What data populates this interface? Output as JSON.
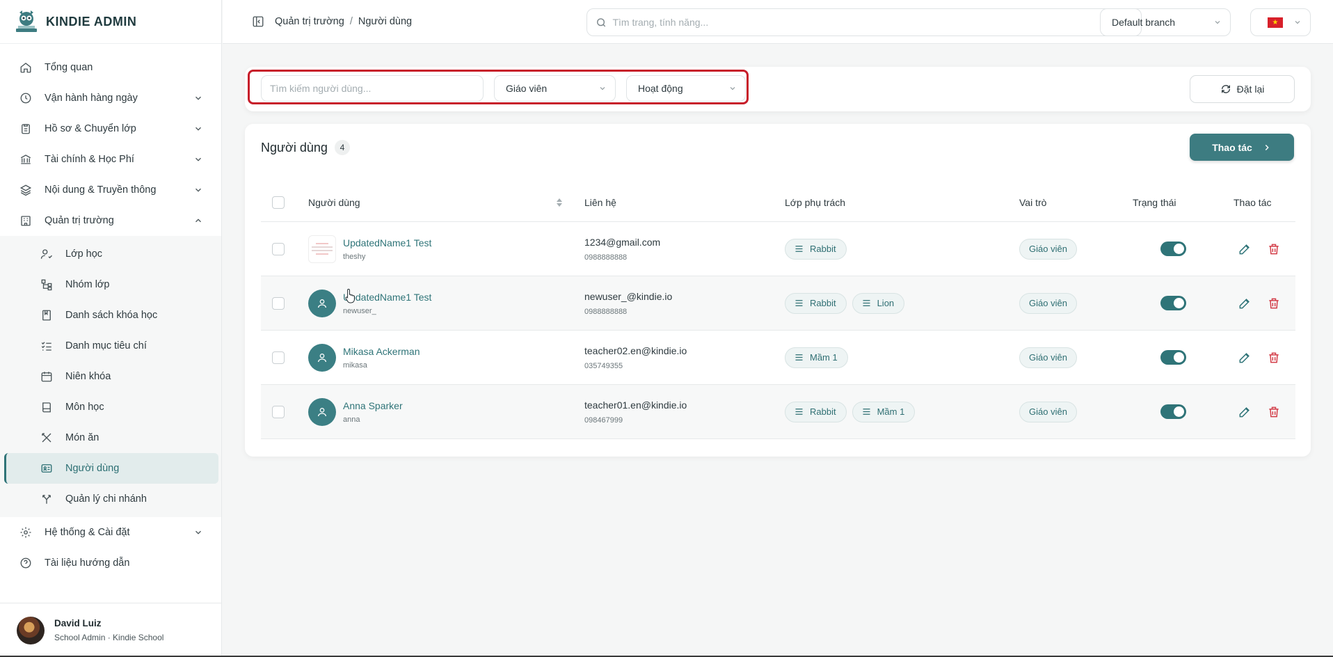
{
  "brand": {
    "name": "KINDIE ADMIN"
  },
  "sidebar": {
    "items": [
      {
        "label": "Tổng quan",
        "icon": "home-icon"
      },
      {
        "label": "Vận hành hàng ngày",
        "icon": "clock-icon"
      },
      {
        "label": "Hồ sơ & Chuyển lớp",
        "icon": "clipboard-icon"
      },
      {
        "label": "Tài chính & Học Phí",
        "icon": "bank-icon"
      },
      {
        "label": "Nội dung & Truyền thông",
        "icon": "layers-icon"
      },
      {
        "label": "Quản trị trường",
        "icon": "building-icon"
      }
    ],
    "subitems": [
      {
        "label": "Lớp học",
        "icon": "user-check-icon"
      },
      {
        "label": "Nhóm lớp",
        "icon": "tree-icon"
      },
      {
        "label": "Danh sách khóa học",
        "icon": "bookmark-icon"
      },
      {
        "label": "Danh mục tiêu chí",
        "icon": "list-check-icon"
      },
      {
        "label": "Niên khóa",
        "icon": "calendar-icon"
      },
      {
        "label": "Môn học",
        "icon": "book-icon"
      },
      {
        "label": "Món ăn",
        "icon": "utensils-icon"
      },
      {
        "label": "Người dùng",
        "icon": "id-card-icon"
      },
      {
        "label": "Quản lý chi nhánh",
        "icon": "branch-icon"
      }
    ],
    "bottom_items": [
      {
        "label": "Hệ thống & Cài đặt",
        "icon": "gear-icon"
      },
      {
        "label": "Tài liệu hướng dẫn",
        "icon": "help-icon"
      }
    ]
  },
  "profile": {
    "name": "David Luiz",
    "role": "School Admin · Kindie School"
  },
  "header": {
    "breadcrumb": [
      "Quản trị trường",
      "/",
      "Người dùng"
    ],
    "search_placeholder": "Tìm trang, tính năng...",
    "branch": "Default branch"
  },
  "filters": {
    "search_placeholder": "Tìm kiếm người dùng...",
    "role": "Giáo viên",
    "status": "Hoạt động",
    "reset_label": "Đặt lại"
  },
  "users_card": {
    "title": "Người dùng",
    "count": "4",
    "action_label": "Thao tác"
  },
  "table": {
    "headers": {
      "user": "Người dùng",
      "contact": "Liên hệ",
      "classes": "Lớp phụ trách",
      "role": "Vai trò",
      "status": "Trạng thái",
      "actions": "Thao tác"
    },
    "rows": [
      {
        "name": "UpdatedName1 Test",
        "username": "theshy",
        "email": "1234@gmail.com",
        "phone": "0988888888",
        "classes": [
          "Rabbit"
        ],
        "role": "Giáo viên",
        "active": true,
        "avatar": "thumbnail"
      },
      {
        "name": "UpdatedName1 Test",
        "username": "newuser_",
        "email": "newuser_@kindie.io",
        "phone": "0988888888",
        "classes": [
          "Rabbit",
          "Lion"
        ],
        "role": "Giáo viên",
        "active": true,
        "avatar": "person-icon"
      },
      {
        "name": "Mikasa Ackerman",
        "username": "mikasa",
        "email": "teacher02.en@kindie.io",
        "phone": "035749355",
        "classes": [
          "Mầm 1"
        ],
        "role": "Giáo viên",
        "active": true,
        "avatar": "person-icon"
      },
      {
        "name": "Anna Sparker",
        "username": "anna",
        "email": "teacher01.en@kindie.io",
        "phone": "098467999",
        "classes": [
          "Rabbit",
          "Mầm 1"
        ],
        "role": "Giáo viên",
        "active": true,
        "avatar": "person-icon"
      }
    ]
  },
  "colors": {
    "accent": "#3d7c81",
    "danger": "#d23b46",
    "highlight": "#c71d2a"
  }
}
